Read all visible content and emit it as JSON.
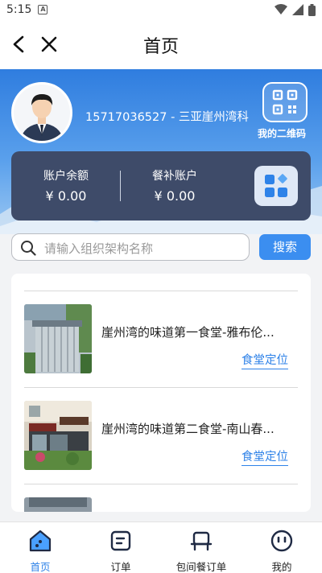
{
  "status_bar": {
    "time": "5:15",
    "a_glyph": "A",
    "icons": [
      "wifi-icon",
      "signal-icon",
      "battery-icon"
    ]
  },
  "nav": {
    "title": "首页",
    "icons": [
      "back-arrow-icon",
      "close-icon"
    ]
  },
  "profile": {
    "user_line": "15717036527 - 三亚崖州湾科",
    "qr_label": "我的二维码"
  },
  "account": {
    "balance_label": "账户余额",
    "balance_value": "¥ 0.00",
    "subsidy_label": "餐补账户",
    "subsidy_value": "¥ 0.00"
  },
  "search": {
    "placeholder": "请输入组织架构名称",
    "button_label": "搜索"
  },
  "canteens": [
    {
      "name": "崖州湾的味道第一食堂-雅布伦...",
      "action": "食堂定位"
    },
    {
      "name": "崖州湾的味道第二食堂-南山春...",
      "action": "食堂定位"
    }
  ],
  "tabbar": {
    "tabs": [
      {
        "label": "首页",
        "active": true
      },
      {
        "label": "订单",
        "active": false
      },
      {
        "label": "包间餐订单",
        "active": false
      },
      {
        "label": "我的",
        "active": false
      }
    ]
  },
  "colors": {
    "accent": "#2e82e8",
    "card_dark": "#3e4b69",
    "hero_blue": "#2f7ddf"
  }
}
